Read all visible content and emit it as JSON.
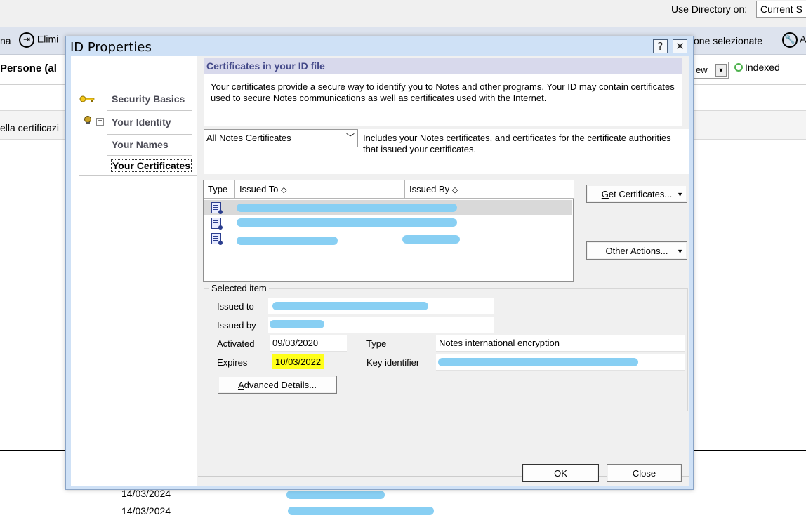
{
  "background": {
    "directory_label": "Use Directory on:",
    "directory_value": "Current S",
    "toolbar": {
      "item1_label": "na",
      "item2_label": "Elimi",
      "item3_label": "one selezionate",
      "item4_label": "A"
    },
    "persone_label": "Persone (al",
    "view_value": "ew",
    "indexed_label": "Indexed",
    "column_header": "ella certificazi",
    "dates": [
      "14/03/2024",
      "14/03/2024"
    ]
  },
  "dialog": {
    "title": "ID Properties",
    "help_button": "?",
    "close_x": "✕",
    "nav": {
      "security_basics": "Security Basics",
      "your_identity": "Your Identity",
      "your_names": "Your Names",
      "your_certificates": "Your Certificates"
    },
    "section_header": "Certificates in your ID file",
    "intro": "Your certificates provide a secure way to identify you to Notes and other programs. Your ID may contain certificates used to secure Notes communications as well as certificates used with the Internet.",
    "filter": {
      "selected": "All Notes Certificates",
      "description": "Includes your Notes certificates, and certificates for the certificate authorities that issued your certificates."
    },
    "list": {
      "headers": {
        "type": "Type",
        "issued_to": "Issued To",
        "issued_by": "Issued By"
      },
      "rows": 3
    },
    "buttons": {
      "get_certificates": {
        "u": "G",
        "rest": "et Certificates..."
      },
      "other_actions": {
        "u": "O",
        "rest": "ther Actions..."
      },
      "advanced_details": {
        "u": "A",
        "rest": "dvanced Details..."
      },
      "ok": "OK",
      "close": "Close"
    },
    "selected_item": {
      "group_title": "Selected item",
      "issued_to_label": "Issued to",
      "issued_by_label": "Issued by",
      "activated_label": "Activated",
      "activated_value": "09/03/2020",
      "expires_label": "Expires",
      "expires_value": "10/03/2022",
      "type_label": "Type",
      "type_value": "Notes international encryption",
      "key_identifier_label": "Key identifier"
    },
    "colors": {
      "highlight": "#ffff1a",
      "redaction": "#88cff3",
      "header_text": "#454a8a"
    }
  }
}
